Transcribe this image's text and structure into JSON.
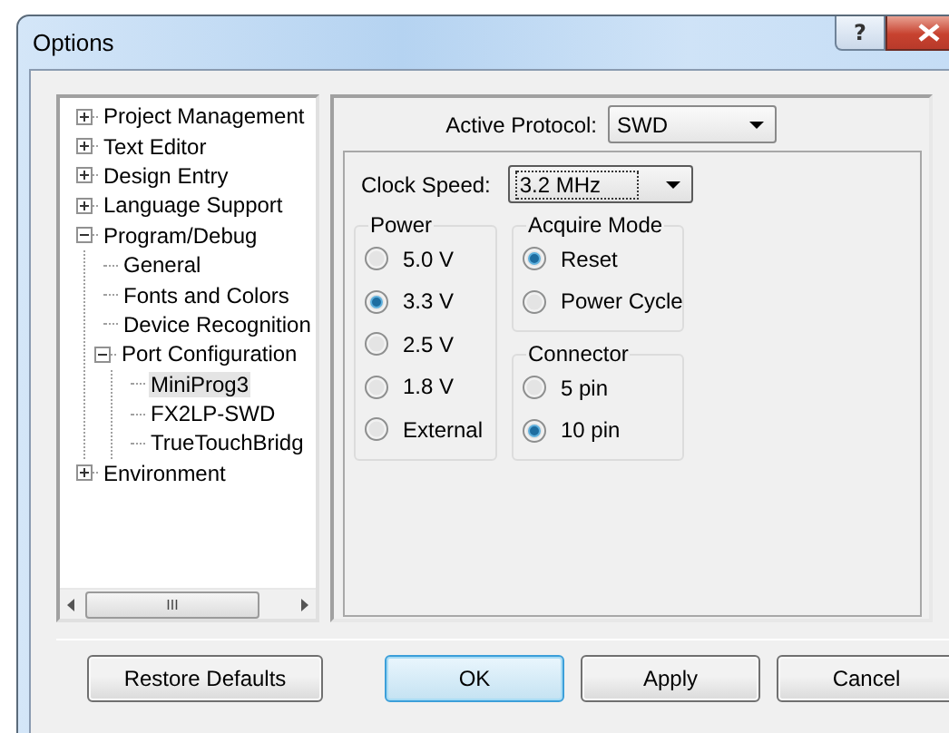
{
  "window": {
    "title": "Options",
    "help_label": "?"
  },
  "tree": {
    "items": [
      {
        "label": "Project Management",
        "expanded": false,
        "selected": false
      },
      {
        "label": "Text Editor",
        "expanded": false,
        "selected": false
      },
      {
        "label": "Design Entry",
        "expanded": false,
        "selected": false
      },
      {
        "label": "Language Support",
        "expanded": false,
        "selected": false
      },
      {
        "label": "Program/Debug",
        "expanded": true,
        "selected": false,
        "children": [
          {
            "label": "General",
            "selected": false
          },
          {
            "label": "Fonts and Colors",
            "selected": false
          },
          {
            "label": "Device Recognition",
            "selected": false
          },
          {
            "label": "Port Configuration",
            "expanded": true,
            "selected": false,
            "children": [
              {
                "label": "MiniProg3",
                "selected": true
              },
              {
                "label": "FX2LP-SWD",
                "selected": false
              },
              {
                "label": "TrueTouchBridg",
                "selected": false
              }
            ]
          }
        ]
      },
      {
        "label": "Environment",
        "expanded": false,
        "selected": false
      }
    ],
    "scrollbar_label": "III"
  },
  "active_protocol": {
    "label": "Active Protocol:",
    "value": "SWD"
  },
  "clock_speed": {
    "label": "Clock Speed:",
    "value": "3.2 MHz"
  },
  "groups": [
    {
      "title": "Power",
      "options": [
        {
          "label": "5.0 V",
          "selected": false
        },
        {
          "label": "3.3 V",
          "selected": true
        },
        {
          "label": "2.5 V",
          "selected": false
        },
        {
          "label": "1.8 V",
          "selected": false
        },
        {
          "label": "External",
          "selected": false
        }
      ]
    },
    {
      "title": "Acquire Mode",
      "options": [
        {
          "label": "Reset",
          "selected": true
        },
        {
          "label": "Power Cycle",
          "selected": false
        }
      ]
    },
    {
      "title": "Connector",
      "options": [
        {
          "label": "5 pin",
          "selected": false
        },
        {
          "label": "10 pin",
          "selected": true
        }
      ]
    }
  ],
  "buttons": [
    {
      "label": "Restore Defaults",
      "default": false
    },
    {
      "label": "OK",
      "default": true
    },
    {
      "label": "Apply",
      "default": false
    },
    {
      "label": "Cancel",
      "default": false
    }
  ]
}
